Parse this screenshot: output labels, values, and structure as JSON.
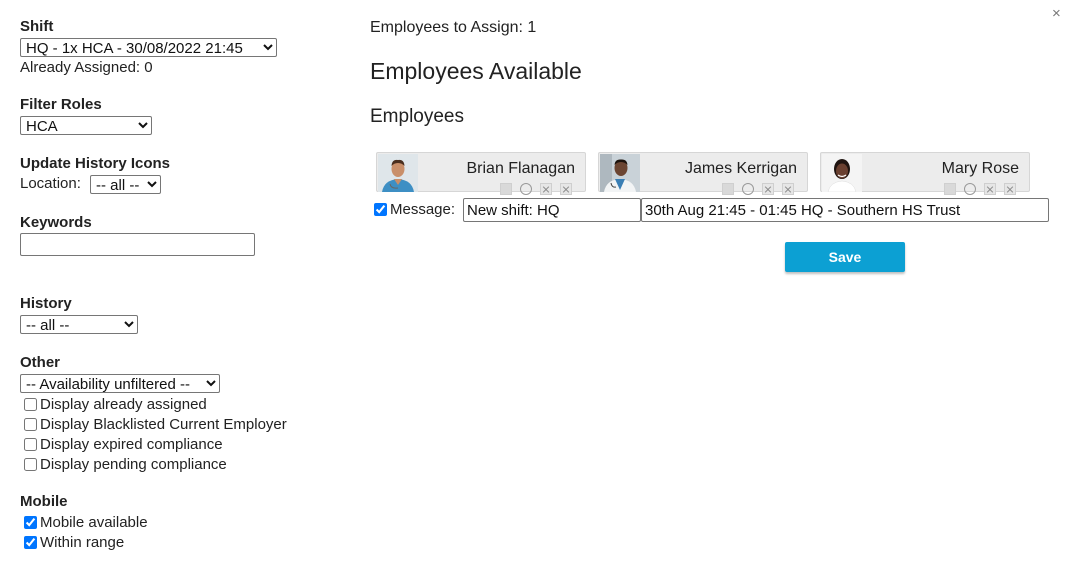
{
  "close_glyph": "×",
  "left": {
    "shift": {
      "label": "Shift",
      "selected": "HQ - 1x HCA - 30/08/2022 21:45",
      "already_assigned": "Already Assigned: 0"
    },
    "filter_roles": {
      "label": "Filter Roles",
      "selected": "HCA"
    },
    "update_history": {
      "label": "Update History Icons",
      "location_label": "Location:",
      "selected": "-- all --"
    },
    "keywords": {
      "label": "Keywords",
      "value": ""
    },
    "history": {
      "label": "History",
      "selected": "-- all --"
    },
    "other": {
      "label": "Other",
      "selected": "-- Availability unfiltered --",
      "checkboxes": [
        {
          "label": "Display already assigned",
          "checked": false
        },
        {
          "label": "Display Blacklisted Current Employer",
          "checked": false
        },
        {
          "label": "Display expired compliance",
          "checked": false
        },
        {
          "label": "Display pending compliance",
          "checked": false
        }
      ]
    },
    "mobile": {
      "label": "Mobile",
      "checkboxes": [
        {
          "label": "Mobile available",
          "checked": true
        },
        {
          "label": "Within range",
          "checked": true
        }
      ]
    }
  },
  "main": {
    "to_assign": "Employees to Assign: 1",
    "heading": "Employees Available",
    "subheading": "Employees",
    "employees": [
      {
        "name": "Brian Flanagan",
        "icons": [
          "status-square-icon",
          "circle-icon",
          "close-x-icon",
          "close-x-icon"
        ]
      },
      {
        "name": "James Kerrigan",
        "icons": [
          "status-square-icon",
          "circle-icon",
          "close-x-icon",
          "close-x-icon"
        ]
      },
      {
        "name": "Mary Rose",
        "icons": [
          "status-square-icon",
          "circle-icon",
          "close-x-icon",
          "close-x-icon"
        ]
      }
    ],
    "message": {
      "checked": true,
      "label": "Message:",
      "subject": "New shift: HQ",
      "body": "30th Aug 21:45 - 01:45 HQ - Southern HS Trust"
    },
    "save_label": "Save"
  },
  "colors": {
    "accent": "#0ca0d3",
    "checkbox": "#0075ff"
  }
}
